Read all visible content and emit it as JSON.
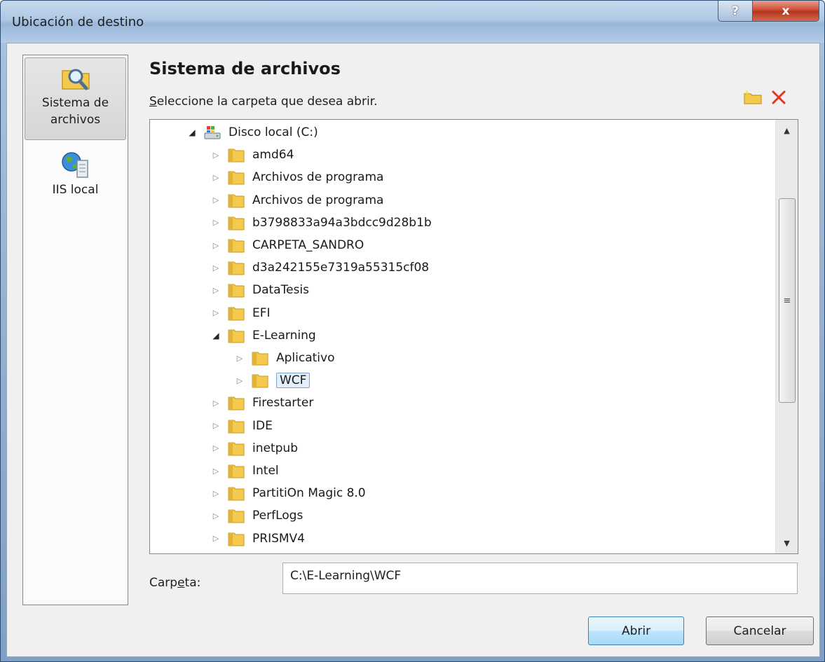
{
  "window": {
    "title": "Ubicación de destino",
    "help_label": "?",
    "close_label": "x"
  },
  "sidebar": {
    "items": [
      {
        "label": "Sistema de archivos",
        "icon": "folder-search-icon",
        "selected": true
      },
      {
        "label": "IIS local",
        "icon": "globe-server-icon",
        "selected": false
      }
    ]
  },
  "main": {
    "heading": "Sistema de archivos",
    "subtitle_first": "S",
    "subtitle_rest": "eleccione la carpeta que desea abrir.",
    "toolbar": {
      "new_folder_icon": "new-folder-icon",
      "delete_icon": "delete-icon"
    }
  },
  "tree": {
    "items": [
      {
        "label": "Disco local (C:)",
        "depth": 0,
        "expanded": true,
        "type": "drive"
      },
      {
        "label": "amd64",
        "depth": 1,
        "expanded": false,
        "type": "folder"
      },
      {
        "label": "Archivos de programa",
        "depth": 1,
        "expanded": false,
        "type": "folder"
      },
      {
        "label": "Archivos de programa",
        "depth": 1,
        "expanded": false,
        "type": "folder"
      },
      {
        "label": "b3798833a94a3bdcc9d28b1b",
        "depth": 1,
        "expanded": false,
        "type": "folder"
      },
      {
        "label": "CARPETA_SANDRO",
        "depth": 1,
        "expanded": false,
        "type": "folder"
      },
      {
        "label": "d3a242155e7319a55315cf08",
        "depth": 1,
        "expanded": false,
        "type": "folder"
      },
      {
        "label": "DataTesis",
        "depth": 1,
        "expanded": false,
        "type": "folder"
      },
      {
        "label": "EFI",
        "depth": 1,
        "expanded": false,
        "type": "folder"
      },
      {
        "label": "E-Learning",
        "depth": 1,
        "expanded": true,
        "type": "folder"
      },
      {
        "label": "Aplicativo",
        "depth": 2,
        "expanded": false,
        "type": "folder"
      },
      {
        "label": "WCF",
        "depth": 2,
        "expanded": false,
        "type": "folder",
        "selected": true
      },
      {
        "label": "Firestarter",
        "depth": 1,
        "expanded": false,
        "type": "folder"
      },
      {
        "label": "IDE",
        "depth": 1,
        "expanded": false,
        "type": "folder"
      },
      {
        "label": "inetpub",
        "depth": 1,
        "expanded": false,
        "type": "folder"
      },
      {
        "label": "Intel",
        "depth": 1,
        "expanded": false,
        "type": "folder"
      },
      {
        "label": "PartitiOn Magic 8.0",
        "depth": 1,
        "expanded": false,
        "type": "folder"
      },
      {
        "label": "PerfLogs",
        "depth": 1,
        "expanded": false,
        "type": "folder"
      },
      {
        "label": "PRISMV4",
        "depth": 1,
        "expanded": false,
        "type": "folder"
      }
    ]
  },
  "folder_field": {
    "label_before": "Carp",
    "label_underlined": "e",
    "label_after": "ta:",
    "value": "C:\\E-Learning\\WCF"
  },
  "buttons": {
    "open": "Abrir",
    "cancel": "Cancelar"
  },
  "colors": {
    "selection_border": "#7da2ce",
    "selection_fill": "#e4effb",
    "delete_red": "#e8341c",
    "folder_yellow": "#f4c94e"
  }
}
